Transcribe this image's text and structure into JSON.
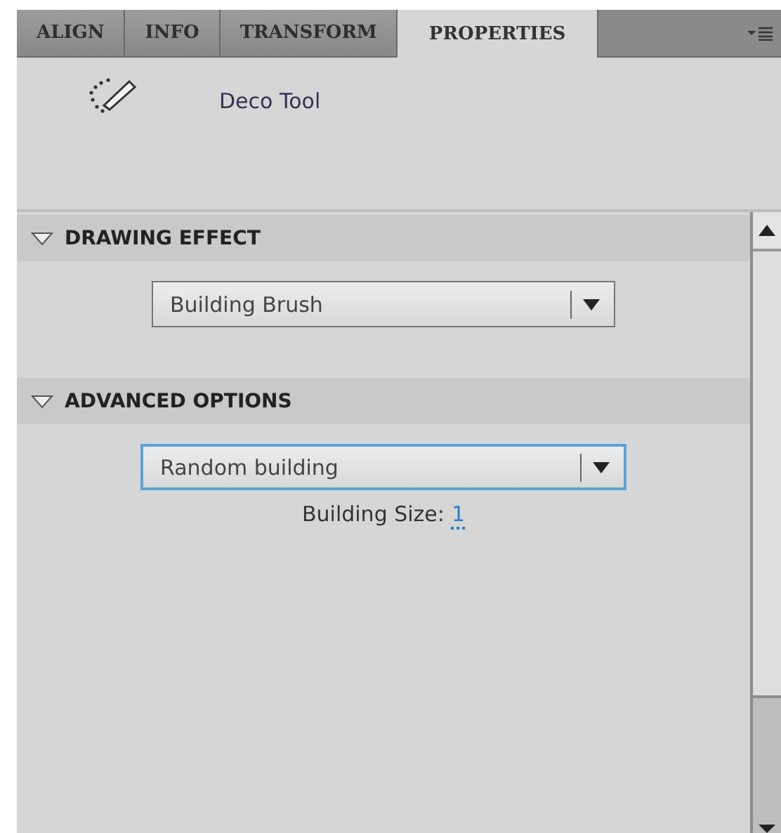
{
  "tabs": [
    {
      "label": "ALIGN",
      "selected": false
    },
    {
      "label": "INFO",
      "selected": false
    },
    {
      "label": "TRANSFORM",
      "selected": false
    },
    {
      "label": "PROPERTIES",
      "selected": true
    }
  ],
  "tool": {
    "name": "Deco Tool"
  },
  "sections": [
    {
      "title": "DRAWING EFFECT",
      "expanded": true,
      "dropdown": {
        "value": "Building Brush",
        "focused": false
      }
    },
    {
      "title": "ADVANCED OPTIONS",
      "expanded": true,
      "dropdown": {
        "value": "Random building",
        "focused": true
      },
      "field": {
        "label": "Building Size:",
        "value": "1"
      }
    }
  ]
}
